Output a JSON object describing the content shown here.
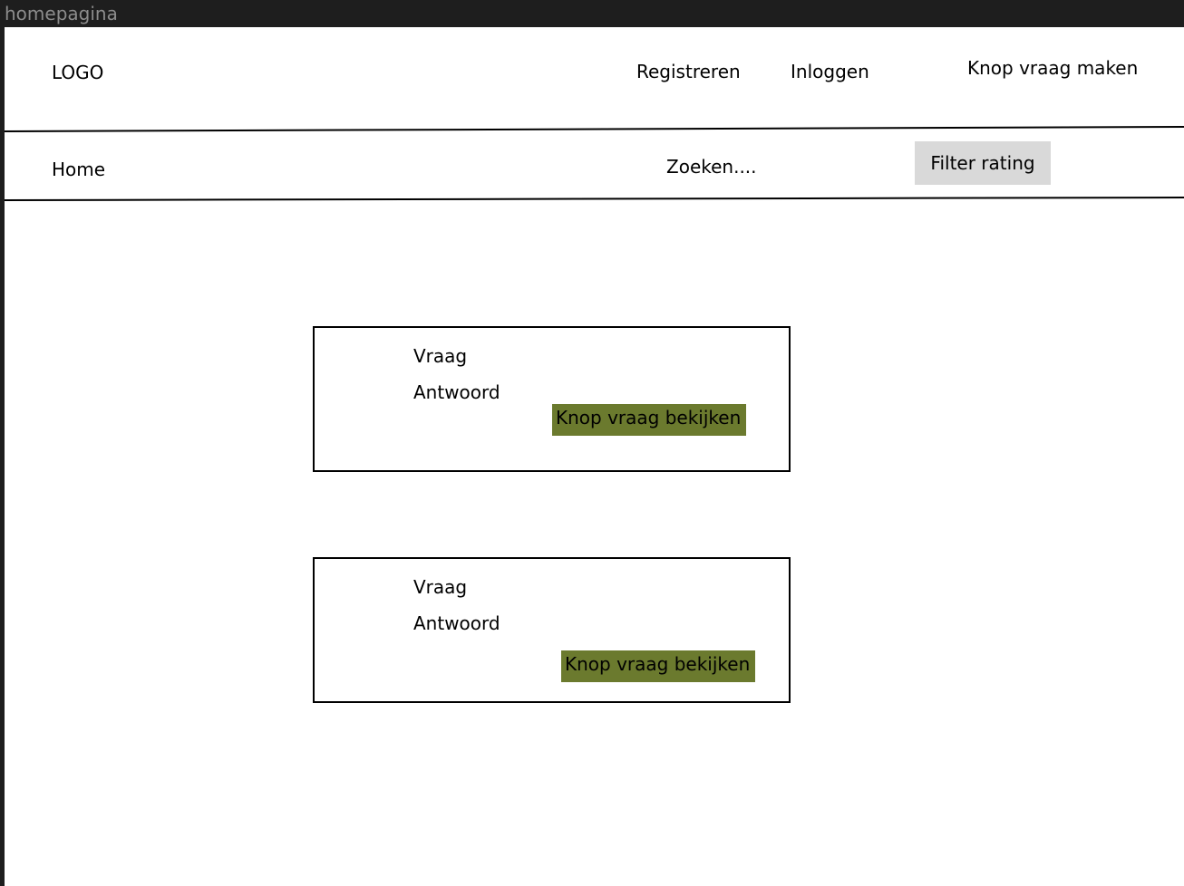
{
  "frame": {
    "label": "homepagina"
  },
  "header": {
    "logo": "LOGO",
    "register": "Registreren",
    "login": "Inloggen",
    "ask_question": "Knop vraag maken"
  },
  "subnav": {
    "home": "Home",
    "search_placeholder": "Zoeken....",
    "filter": "Filter rating"
  },
  "cards": [
    {
      "question": "Vraag",
      "answer": "Antwoord",
      "button": "Knop vraag bekijken"
    },
    {
      "question": "Vraag",
      "answer": "Antwoord",
      "button": "Knop vraag bekijken"
    }
  ],
  "colors": {
    "button_green": "#6b7a2e",
    "filter_gray": "#d9d9d9"
  }
}
